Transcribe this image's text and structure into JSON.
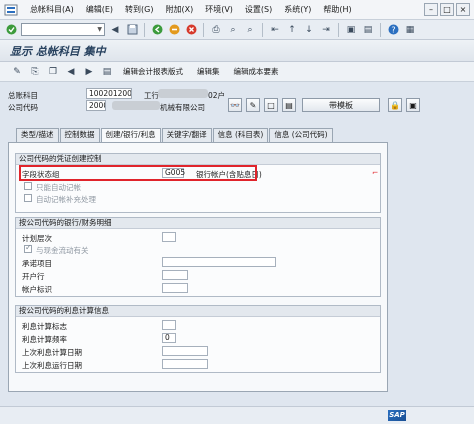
{
  "menubar": {
    "items": [
      "总帐科目(A)",
      "编辑(E)",
      "转到(G)",
      "附加(X)",
      "环境(V)",
      "设置(S)",
      "系统(Y)",
      "帮助(H)"
    ]
  },
  "stdbar": {
    "icons": [
      "enter-icon",
      "save-icon",
      "back-icon",
      "exit-icon",
      "cancel-icon",
      "print-icon",
      "find-icon",
      "find-next-icon",
      "first-page-icon",
      "prev-page-icon",
      "next-page-icon",
      "last-page-icon",
      "create-session-icon",
      "shortcut-icon",
      "help-icon",
      "customize-icon"
    ]
  },
  "title": "显示 总帐科目 集中",
  "appbar": {
    "edit_chart_label": "编辑会计报表版式",
    "edit_set_label": "编辑集",
    "edit_cost_element_label": "编辑成本要素"
  },
  "header": {
    "gl_account_label": "总账科目",
    "gl_account_value": "1002012002",
    "gl_account_suffix": "工行",
    "gl_account_tail": "02户",
    "company_code_label": "公司代码",
    "company_code_value": "2000",
    "company_name": "机械有限公司",
    "template_button": "带模板"
  },
  "tabs": [
    {
      "label": "类型/描述",
      "active": false
    },
    {
      "label": "控制数据",
      "active": false
    },
    {
      "label": "创建/银行/利息",
      "active": true
    },
    {
      "label": "关键字/翻译",
      "active": false
    },
    {
      "label": "信息 (科目表)",
      "active": false
    },
    {
      "label": "信息 (公司代码)",
      "active": false
    }
  ],
  "group_entry": {
    "title": "公司代码的凭证创建控制",
    "field_status_label": "字段状态组",
    "field_status_value": "G005",
    "field_status_desc": "银行帐户(含贴息日)",
    "auto_post_label": "只能自动记帐",
    "supplement_label": "自动记帐补充处理"
  },
  "group_bank": {
    "title": "按公司代码的银行/财务明细",
    "planning_level_label": "计划层次",
    "cash_related_label": "与现金流动有关",
    "commitment_label": "承诺项目",
    "house_bank_label": "开户行",
    "account_id_label": "帐户标识"
  },
  "group_interest": {
    "title": "按公司代码的利息计算信息",
    "interest_indicator_label": "利息计算标志",
    "interest_frequency_label": "利息计算频率",
    "interest_frequency_value": "0",
    "last_key_date_label": "上次利息计算日期",
    "last_run_date_label": "上次利息运行日期"
  },
  "status": {
    "sap_logo_text": "SAP"
  },
  "colors": {
    "highlight": "#e0242b",
    "title_text": "#27415e"
  }
}
